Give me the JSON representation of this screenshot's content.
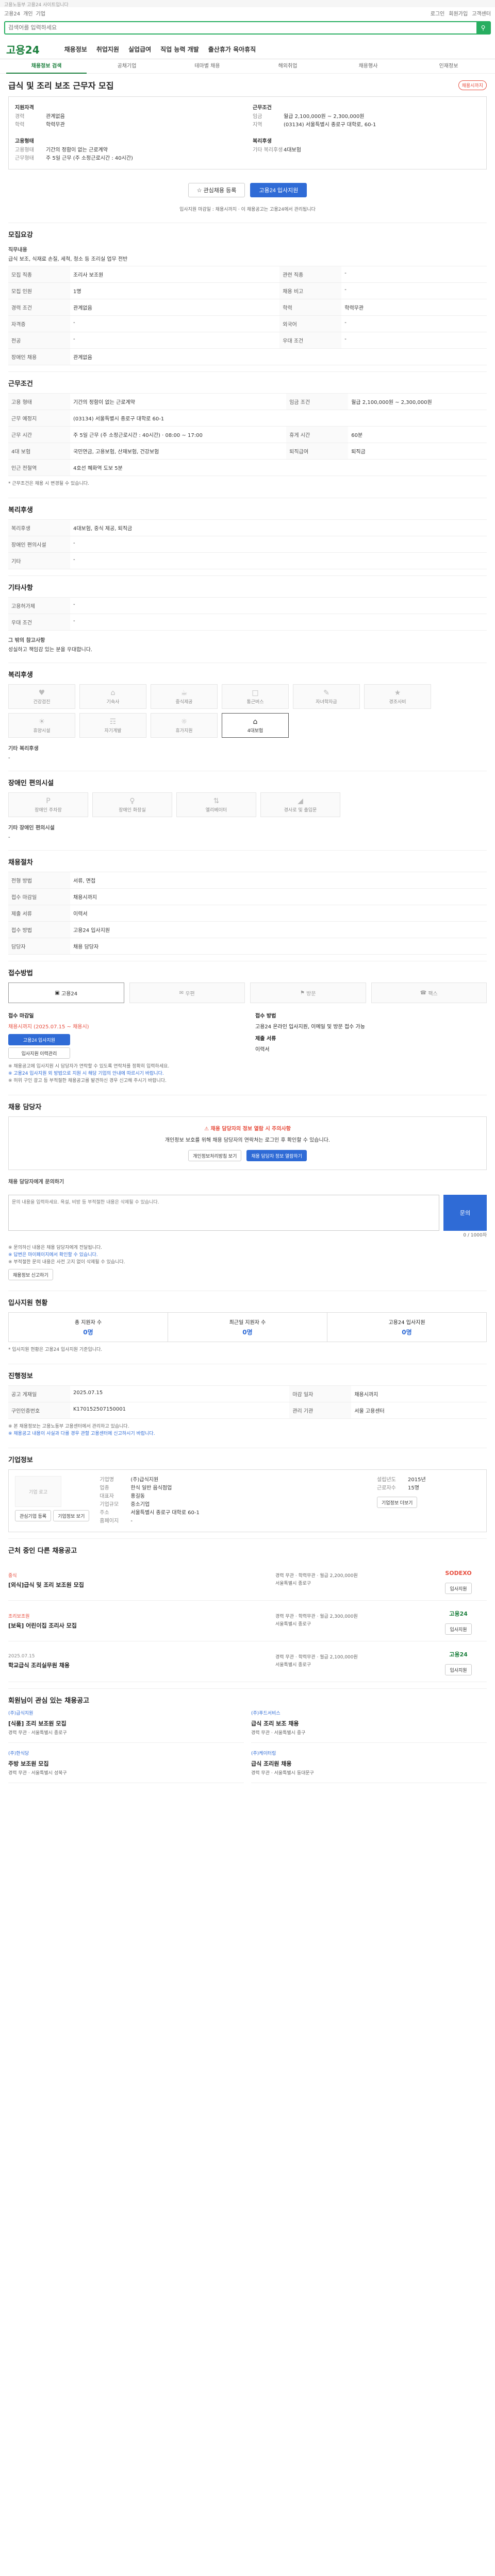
{
  "util": {
    "text": "고용노동부 고용24 사이트입니다"
  },
  "top": {
    "left": [
      "고용24",
      "개인",
      "기업"
    ],
    "right": [
      "로그인",
      "회원가입",
      "고객센터"
    ]
  },
  "search": {
    "placeholder": "검색어를 입력하세요"
  },
  "gnb": {
    "logo": "고용24",
    "menu": [
      "채용정보",
      "취업지원",
      "실업급여",
      "직업 능력 개발",
      "출산휴가 육아휴직"
    ]
  },
  "subnav": [
    "채용정보 검색",
    "공채기업",
    "테마별 채용",
    "해외취업",
    "채용행사",
    "인재정보"
  ],
  "job": {
    "title": "급식 및 조리 보조 근무자 모집",
    "badge": "채용시까지",
    "left_heading": "지원자격",
    "left_rows": [
      [
        "경력",
        "관계없음"
      ],
      [
        "학력",
        "학력무관"
      ]
    ],
    "left_heading2": "고용형태",
    "left_rows2": [
      [
        "고용형태",
        "기간의 정함이 없는 근로계약"
      ],
      [
        "근무형태",
        "주 5일 근무 (주 소정근로시간 : 40시간)"
      ]
    ],
    "right_heading": "근무조건",
    "right_rows": [
      [
        "임금",
        "월급 2,100,000원 ~ 2,300,000원"
      ],
      [
        "지역",
        "(03134) 서울특별시 종로구 대학로, 60-1"
      ]
    ],
    "right_heading2": "복리후생",
    "right_rows2": [
      [
        "기타 복리후생",
        "4대보험"
      ]
    ],
    "btn_save": "관심채용 등록",
    "btn_apply": "고용24 입사지원",
    "deadline_note": "입사지원 마감일 : 채용시까지 · 이 채용공고는 고용24에서 관리됩니다"
  },
  "recruit": {
    "title": "모집요강",
    "job_desc_label": "직무내용",
    "job_desc": "급식 보조, 식재료 손질, 세척, 청소 등 조리실 업무 전반",
    "rows": [
      [
        "모집 직종",
        "조리사 보조원",
        "관련 직종",
        "-"
      ],
      [
        "모집 인원",
        "1명",
        "채용 비고",
        "-"
      ],
      [
        "경력 조건",
        "관계없음",
        "학력",
        "학력무관"
      ],
      [
        "자격증",
        "-",
        "외국어",
        "-"
      ],
      [
        "전공",
        "-",
        "우대 조건",
        "-"
      ],
      [
        "장애인 채용",
        "관계없음",
        "",
        ""
      ]
    ]
  },
  "conditions": {
    "title": "근무조건",
    "rows": [
      [
        "고용 형태",
        "기간의 정함이 없는 근로계약",
        "임금 조건",
        "월급 2,100,000원 ~ 2,300,000원"
      ],
      [
        "근무 예정지",
        "(03134) 서울특별시 종로구 대학로 60-1",
        "",
        ""
      ],
      [
        "근무 시간",
        "주 5일 근무 (주 소정근로시간 : 40시간) · 08:00 ~ 17:00",
        "휴게 시간",
        "60분"
      ],
      [
        "4대 보험",
        "국민연금, 고용보험, 산재보험, 건강보험",
        "퇴직급여",
        "퇴직금"
      ],
      [
        "인근 전철역",
        "4호선 혜화역 도보 5분",
        "",
        ""
      ]
    ],
    "footnote": "* 근무조건은 채용 시 변경될 수 있습니다."
  },
  "welfare": {
    "title": "복리후생",
    "rows": [
      [
        "복리후생",
        "4대보험, 중식 제공, 퇴직금"
      ],
      [
        "장애인 편의시설",
        "-"
      ],
      [
        "기타",
        "-"
      ]
    ]
  },
  "extra": {
    "title": "기타사항",
    "rows": [
      [
        "고용허가제",
        "-"
      ],
      [
        "우대 조건",
        "-"
      ]
    ],
    "etc_label": "그 밖의 참고사항",
    "etc": "성실하고 책임감 있는 분을 우대합니다."
  },
  "facilities": {
    "title": "복리후생",
    "items": [
      "건강검진",
      "기숙사",
      "중식제공",
      "통근버스",
      "자녀학자금",
      "경조사비",
      "휴양시설",
      "자기계발",
      "휴가지원",
      "4대보험"
    ],
    "active": [
      9
    ],
    "sub_label": "기타 복리후생",
    "sub_value": "-"
  },
  "disabled": {
    "title": "장애인 편의시설",
    "items": [
      "장애인 주차장",
      "장애인 화장실",
      "엘리베이터",
      "경사로 및 출입문"
    ],
    "note_label": "기타 장애인 편의시설",
    "note": "-"
  },
  "recruiter": {
    "title": "채용절차",
    "rows": [
      [
        "전형 방법",
        "서류, 면접"
      ],
      [
        "접수 마감일",
        "채용시까지"
      ],
      [
        "제출 서류",
        "이력서"
      ],
      [
        "접수 방법",
        "고용24 입사지원"
      ],
      [
        "담당자",
        "채용 담당자"
      ]
    ]
  },
  "apply_method": {
    "title": "접수방법",
    "items": [
      "고용24",
      "우편",
      "방문",
      "팩스"
    ],
    "active": [
      0
    ],
    "col1_title": "접수 마감일",
    "col1": "채용시까지 (2025.07.15 ~ 채용시)",
    "col1_btn": "고용24 입사지원",
    "col1_btn2": "입사지원 이력관리",
    "col2_title": "접수 방법",
    "col2": "고용24 온라인 입사지원, 이메일 및 방문 접수 가능",
    "col2_label": "제출 서류",
    "col2_value": "이력서",
    "notes": [
      "※ 채용공고에 입사지원 시 담당자가 연락할 수 있도록 연락처를 정확히 입력하세요.",
      "※ 고용24 입사지원 외 방법으로 지원 시 해당 기업의 안내에 따르시기 바랍니다.",
      "※ 허위 구인 광고 등 부적절한 채용공고를 발견하신 경우 신고해 주시기 바랍니다."
    ]
  },
  "contact": {
    "title": "채용 담당자",
    "alert": "채용 담당자의 정보 열람 시 주의사항",
    "text": "개인정보 보호를 위해 채용 담당자의 연락처는 로그인 후 확인할 수 있습니다.",
    "btn1": "개인정보처리방침 보기",
    "btn2": "채용 담당자 정보 열람하기",
    "qna_label": "채용 담당자에게 문의하기",
    "qna_placeholder": "문의 내용을 입력하세요. 욕설, 비방 등 부적절한 내용은 삭제될 수 있습니다.",
    "qna_btn": "문의",
    "qna_count": "0 / 1000자",
    "notes": [
      "※ 문의하신 내용은 채용 담당자에게 전달됩니다.",
      "※ 답변은 마이페이지에서 확인할 수 있습니다.",
      "※ 부적절한 문의 내용은 사전 고지 없이 삭제될 수 있습니다."
    ],
    "note_btn": "채용정보 신고하기"
  },
  "status": {
    "title": "입사지원 현황",
    "items": [
      [
        "총 지원자 수",
        "0명"
      ],
      [
        "최근일 지원자 수",
        "0명"
      ],
      [
        "고용24 입사지원",
        "0명"
      ]
    ],
    "note": "* 입사지원 현황은 고용24 입사지원 기준입니다."
  },
  "summary": {
    "title": "진행정보",
    "rows": [
      [
        "공고 게재일",
        "2025.07.15",
        "마감 일자",
        "채용시까지"
      ],
      [
        "구인인증번호",
        "K170152507150001",
        "관리 기관",
        "서울 고용센터"
      ]
    ],
    "notes": [
      "※ 본 채용정보는 고용노동부 고용센터에서 관리하고 있습니다.",
      "※ 채용공고 내용이 사실과 다를 경우 관할 고용센터에 신고하시기 바랍니다."
    ]
  },
  "company": {
    "title": "기업정보",
    "logo": "기업 로고",
    "btn1": "관심기업 등록",
    "btn2": "기업정보 보기",
    "rows": [
      [
        "기업명",
        "(주)급식지원"
      ],
      [
        "업종",
        "한식 일반 음식점업"
      ],
      [
        "대표자",
        "홍길동"
      ],
      [
        "기업규모",
        "중소기업"
      ],
      [
        "주소",
        "서울특별시 종로구 대학로 60-1"
      ],
      [
        "홈페이지",
        "-"
      ]
    ],
    "side": [
      [
        "설립년도",
        "2015년"
      ],
      [
        "근로자수",
        "15명"
      ]
    ],
    "side_btn": "기업정보 더보기"
  },
  "nearby": {
    "title": "근처 중인 다른 채용공고",
    "items": [
      {
        "cat": "중식",
        "title": "[외식]급식 및 조리 보조원 모집",
        "info": "경력 무관 · 학력무관 · 월급 2,200,000원",
        "loc": "서울특별시 종로구",
        "corp": "SODEXO",
        "btn": "입사지원"
      },
      {
        "cat": "조리보조원",
        "title": "[보육] 어린이집 조리사 모집",
        "info": "경력 무관 · 학력무관 · 월급 2,300,000원",
        "loc": "서울특별시 종로구",
        "corp": "고용24",
        "btn": "입사지원"
      },
      {
        "cat": "2025.07.15",
        "title": "학교급식 조리실무원 채용",
        "info": "경력 무관 · 학력무관 · 월급 2,100,000원",
        "loc": "서울특별시 종로구",
        "corp": "고용24",
        "btn": "입사지원"
      }
    ]
  },
  "favorites": {
    "title": "회원님이 관심 있는 채용공고",
    "items": [
      {
        "corp": "(주)급식지원",
        "title": "[식품] 조리 보조원 모집",
        "info": "경력 무관 · 서울특별시 종로구"
      },
      {
        "corp": "(주)푸드서비스",
        "title": "급식 조리 보조 채용",
        "info": "경력 무관 · 서울특별시 중구"
      },
      {
        "corp": "(주)한식당",
        "title": "주방 보조원 모집",
        "info": "경력 무관 · 서울특별시 성북구"
      },
      {
        "corp": "(주)케이터링",
        "title": "급식 조리원 채용",
        "info": "경력 무관 · 서울특별시 동대문구"
      }
    ]
  }
}
